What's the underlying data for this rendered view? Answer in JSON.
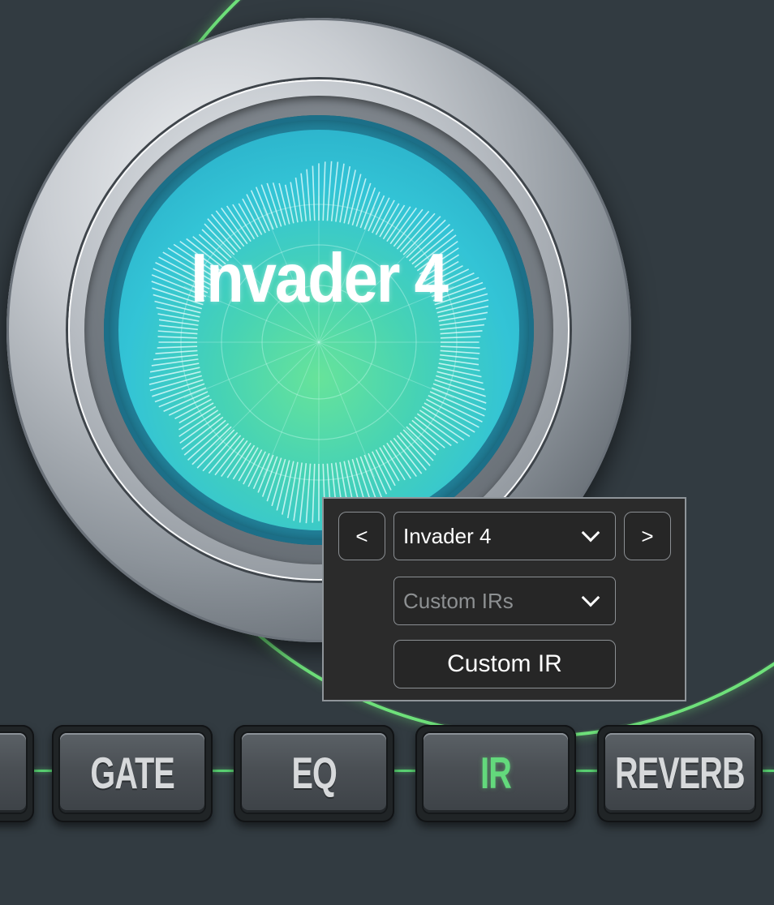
{
  "knob": {
    "title": "Invader 4"
  },
  "ir_panel": {
    "prev_label": "<",
    "next_label": ">",
    "preset_select_value": "Invader 4",
    "category_select_value": "Custom IRs",
    "custom_ir_button_label": "Custom IR"
  },
  "modules": [
    {
      "label": "GATE",
      "active": false
    },
    {
      "label": "EQ",
      "active": false
    },
    {
      "label": "IR",
      "active": true
    },
    {
      "label": "REVERB",
      "active": false
    }
  ],
  "colors": {
    "background": "#323b41",
    "accent_green": "#63d97c",
    "screen_cyan": "#33c4d6",
    "panel": "#2b2b2b"
  }
}
